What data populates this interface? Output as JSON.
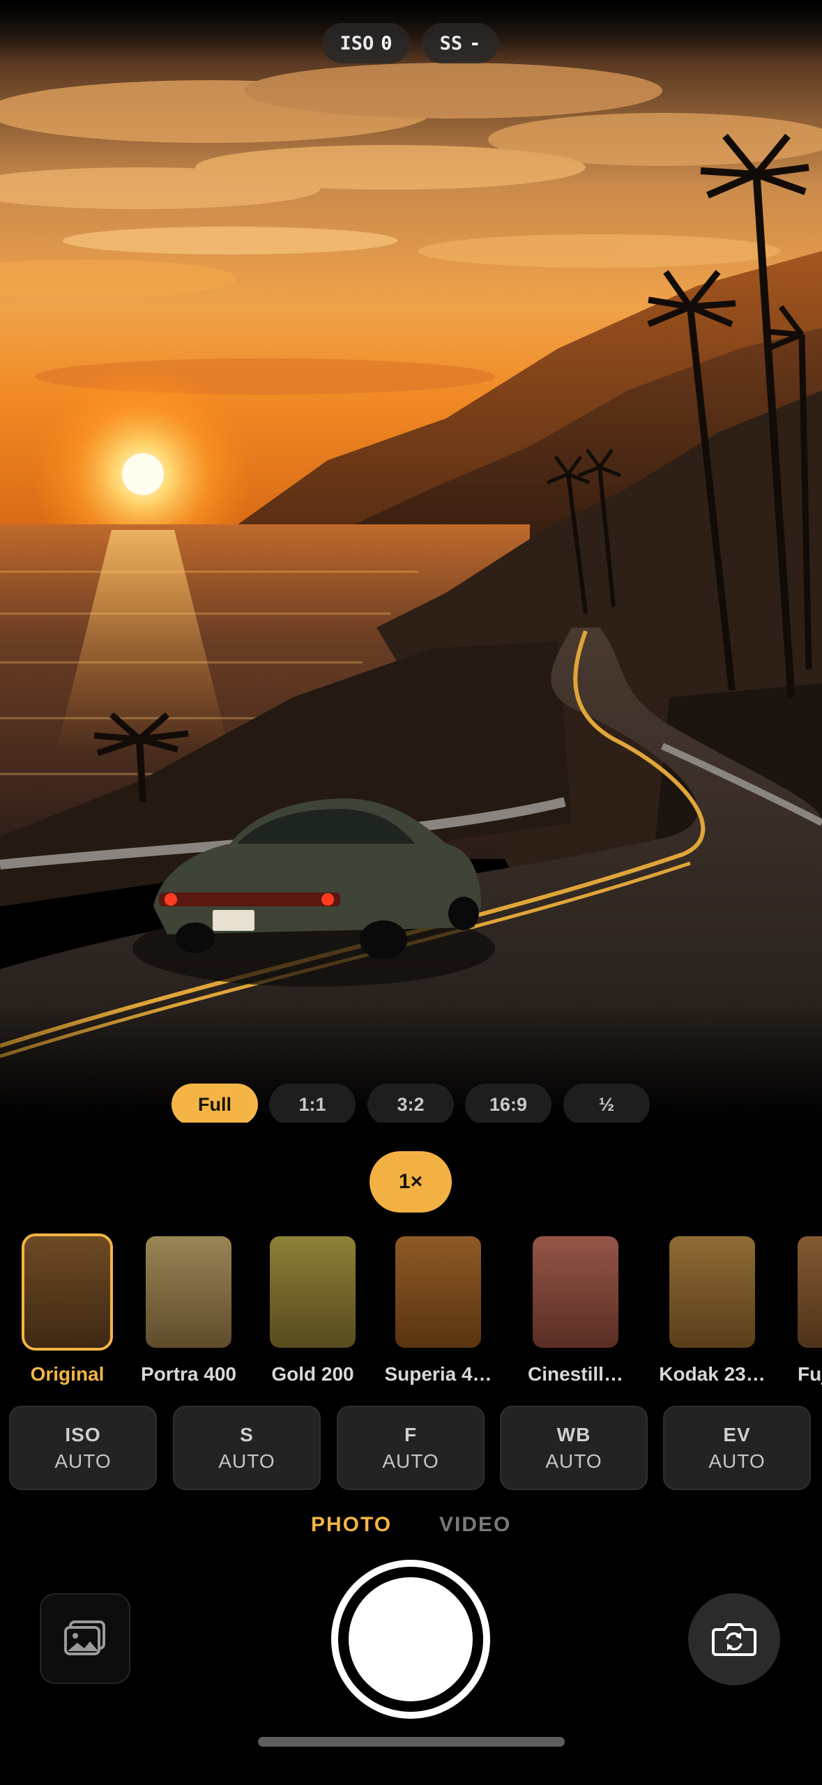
{
  "top_readouts": {
    "iso": {
      "label": "ISO",
      "value": "0"
    },
    "shutter": {
      "label": "SS",
      "value": "-"
    }
  },
  "aspect_ratios": [
    {
      "label": "Full",
      "active": true
    },
    {
      "label": "1:1",
      "active": false
    },
    {
      "label": "3:2",
      "active": false
    },
    {
      "label": "16:9",
      "active": false
    },
    {
      "label": "½",
      "active": false
    }
  ],
  "zoom": {
    "label": "1×"
  },
  "film_presets": [
    {
      "label": "Original",
      "color": "#5a3b1d",
      "active": true
    },
    {
      "label": "Portra 400",
      "color": "#8a7548",
      "active": false
    },
    {
      "label": "Gold 200",
      "color": "#7d7032",
      "active": false
    },
    {
      "label": "Superia 4…",
      "color": "#7a4a20",
      "active": false
    },
    {
      "label": "Cinestill…",
      "color": "#7d4336",
      "active": false
    },
    {
      "label": "Kodak 23…",
      "color": "#7c5a2c",
      "active": false
    },
    {
      "label": "Fuj",
      "color": "#6e4a28",
      "active": false
    }
  ],
  "manual_controls": [
    {
      "key": "ISO",
      "value": "AUTO"
    },
    {
      "key": "S",
      "value": "AUTO"
    },
    {
      "key": "F",
      "value": "AUTO"
    },
    {
      "key": "WB",
      "value": "AUTO"
    },
    {
      "key": "EV",
      "value": "AUTO"
    }
  ],
  "modes": {
    "photo": "PHOTO",
    "video": "VIDEO",
    "active": "photo"
  },
  "icons": {
    "gallery": "gallery-icon",
    "flip_camera": "camera-flip-icon",
    "shutter": "shutter-button"
  },
  "colors": {
    "accent": "#f4b446",
    "background": "#000000"
  }
}
